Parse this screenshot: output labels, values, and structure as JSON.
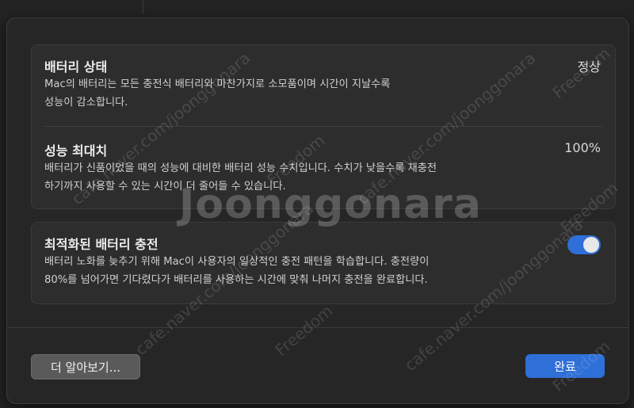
{
  "battery_health": {
    "title": "배터리 상태",
    "value": "정상",
    "description_line1": "Mac의 배터리는 모든 충전식 배터리와 마찬가지로 소모품이며 시간이 지날수록",
    "description_line2": "성능이 감소합니다."
  },
  "max_capacity": {
    "title": "성능 최대치",
    "value": "100%",
    "description_line1": "배터리가 신품이었을 때의 성능에 대비한 배터리 성능 수치입니다. 수치가 낮을수록 재충전",
    "description_line2": "하기까지 사용할 수 있는 시간이 더 줄어들 수 있습니다."
  },
  "optimized_charging": {
    "title": "최적화된 배터리 충전",
    "enabled": true,
    "description_line1": "배터리 노화를 늦추기 위해 Mac이 사용자의 일상적인 충전 패턴을 학습합니다. 충전량이",
    "description_line2": "80%를 넘어가면 기다렸다가 배터리를 사용하는 시간에 맞춰 나머지 충전을 완료합니다."
  },
  "buttons": {
    "learn_more": "더 알아보기...",
    "done": "완료"
  },
  "watermark": {
    "main": "Joonggonara",
    "site": "cafe.naver.com/joonggonara",
    "freedom": "Freedom"
  },
  "colors": {
    "accent": "#2f6fd8",
    "sheet_bg": "#262626",
    "group_bg": "#2d2d2d"
  }
}
